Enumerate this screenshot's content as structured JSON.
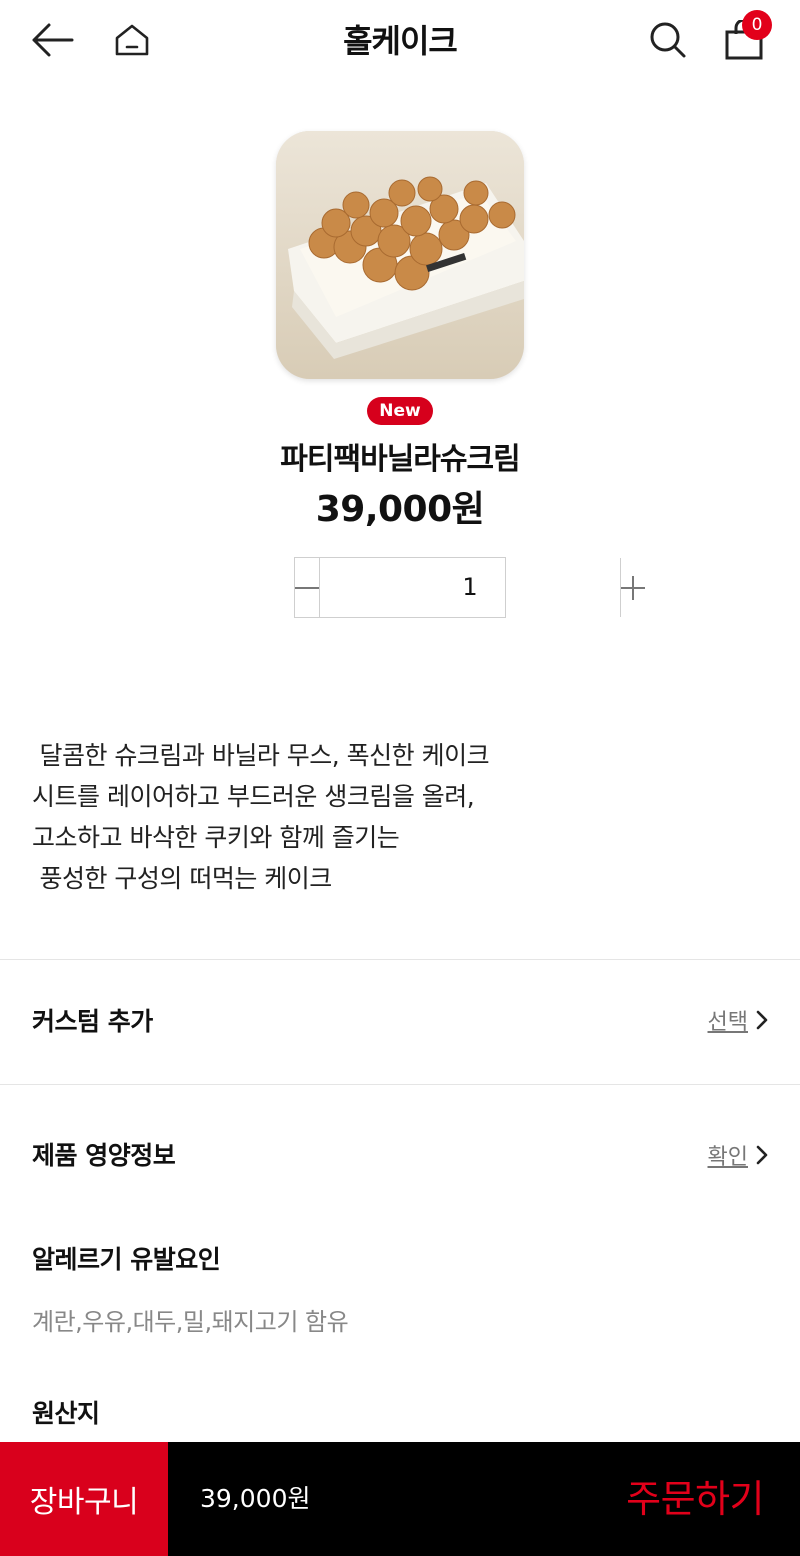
{
  "header": {
    "title": "홀케이크",
    "cart_count": "0",
    "icons": [
      "back-arrow-icon",
      "home-icon",
      "search-icon",
      "shopping-bag-icon"
    ]
  },
  "product": {
    "badge": "New",
    "name": "파티팩바닐라슈크림",
    "price": "39,000원",
    "quantity": "1",
    "description": [
      " 달콤한 슈크림과 바닐라 무스, 폭신한 케이크",
      "시트를 레이어하고 부드러운 생크림을 올려,",
      "고소하고 바삭한 쿠키와 함께 즐기는",
      " 풍성한 구성의 떠먹는 케이크"
    ]
  },
  "custom": {
    "label": "커스텀 추가",
    "action": "선택"
  },
  "nutrition": {
    "label": "제품 영양정보",
    "action": "확인"
  },
  "allergens": {
    "label": "알레르기 유발요인",
    "text": "계란,우유,대두,밀,돼지고기 함유"
  },
  "origin": {
    "label": "원산지"
  },
  "bottom_bar": {
    "cart_label": "장바구니",
    "total": "39,000원",
    "order_label": "주문하기"
  },
  "colors": {
    "accent": "#d9001c",
    "bar": "#000000"
  }
}
